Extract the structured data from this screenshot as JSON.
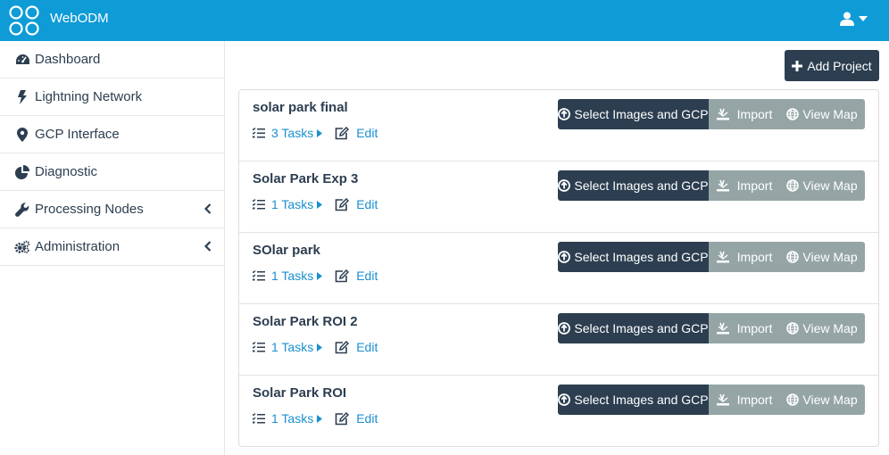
{
  "app": {
    "brand": "WebODM"
  },
  "sidebar": {
    "items": [
      {
        "label": "Dashboard",
        "icon": "dashboard-icon"
      },
      {
        "label": "Lightning Network",
        "icon": "bolt-icon"
      },
      {
        "label": "GCP Interface",
        "icon": "map-marker-icon"
      },
      {
        "label": "Diagnostic",
        "icon": "pie-chart-icon"
      },
      {
        "label": "Processing Nodes",
        "icon": "wrench-icon",
        "chevron": true
      },
      {
        "label": "Administration",
        "icon": "cogs-icon",
        "chevron": true
      }
    ]
  },
  "toolbar": {
    "add_project_label": "Add Project"
  },
  "project_actions": {
    "select_label": "Select Images and GCP",
    "import_label": "Import",
    "map_label": "View Map",
    "edit_label": "Edit"
  },
  "projects": [
    {
      "name": "solar park final",
      "tasks": "3 Tasks"
    },
    {
      "name": "Solar Park Exp 3",
      "tasks": "1 Tasks"
    },
    {
      "name": "SOlar park",
      "tasks": "1 Tasks"
    },
    {
      "name": "Solar Park ROI 2",
      "tasks": "1 Tasks"
    },
    {
      "name": "Solar Park ROI",
      "tasks": "1 Tasks"
    }
  ],
  "colors": {
    "topbar": "#0e9bd6",
    "primary": "#2c3e50",
    "secondary": "#95a5a6",
    "link": "#1a8fd0"
  }
}
